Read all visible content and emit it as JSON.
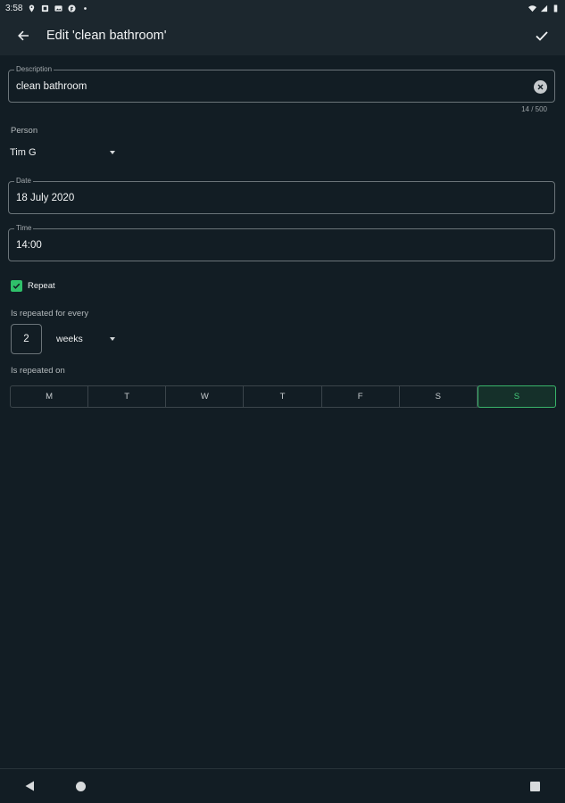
{
  "status_bar": {
    "time": "3:58",
    "icons": [
      "location-icon",
      "message-icon",
      "gallery-icon",
      "app-icon",
      "dot-icon",
      "wifi-icon",
      "signal-icon",
      "battery-icon"
    ]
  },
  "app_bar": {
    "title": "Edit 'clean bathroom'",
    "back_icon": "arrow-back-icon",
    "confirm_icon": "check-icon"
  },
  "description": {
    "label": "Description",
    "value": "clean bathroom",
    "counter": "14 / 500"
  },
  "person": {
    "label": "Person",
    "value": "Tim G"
  },
  "date": {
    "label": "Date",
    "value": "18 July 2020"
  },
  "time": {
    "label": "Time",
    "value": "14:00"
  },
  "repeat": {
    "label": "Repeat",
    "checked": true,
    "every_label": "Is repeated for every",
    "interval": "2",
    "unit": "weeks",
    "on_label": "Is repeated on",
    "days": [
      {
        "label": "M",
        "selected": false
      },
      {
        "label": "T",
        "selected": false
      },
      {
        "label": "W",
        "selected": false
      },
      {
        "label": "T",
        "selected": false
      },
      {
        "label": "F",
        "selected": false
      },
      {
        "label": "S",
        "selected": false
      },
      {
        "label": "S",
        "selected": true
      }
    ]
  },
  "colors": {
    "background": "#121d24",
    "app_bar": "#1c272e",
    "accent": "#2fc06a"
  },
  "nav_bar": {
    "icons": [
      "nav-back-icon",
      "nav-home-icon",
      "nav-recents-icon"
    ]
  }
}
